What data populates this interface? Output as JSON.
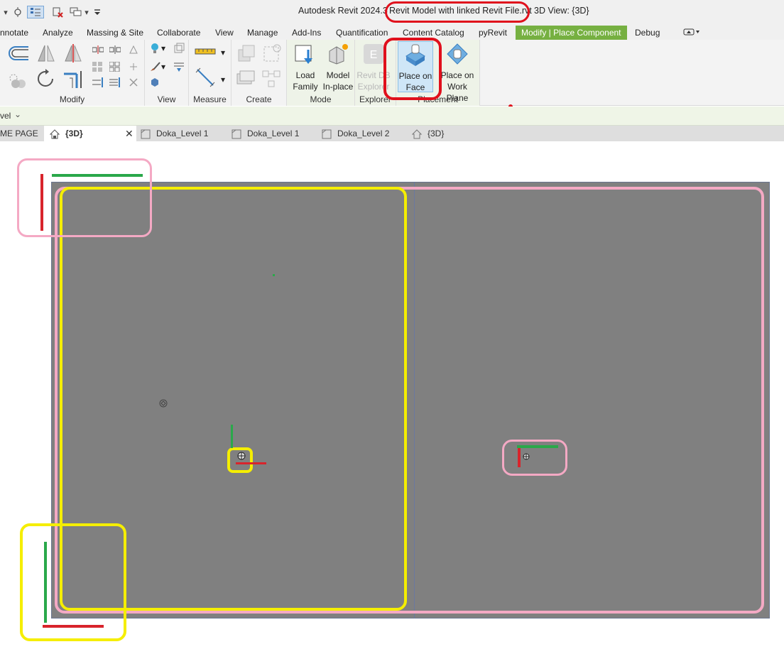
{
  "window": {
    "app_title": "Autodesk Revit 2024.3",
    "file_name": "Revit Model with linked Revit File.rvt",
    "view_title": "3D View: {3D}"
  },
  "ribbon_tabs": [
    "nnotate",
    "Analyze",
    "Massing & Site",
    "Collaborate",
    "View",
    "Manage",
    "Add-Ins",
    "Quantification",
    "Content Catalog",
    "pyRevit",
    "Modify | Place Component",
    "Debug"
  ],
  "ribbon": {
    "panels": {
      "modify": "Modify",
      "view": "View",
      "measure": "Measure",
      "create": "Create",
      "mode": "Mode",
      "explorer": "Explorer",
      "placement": "Placement"
    },
    "buttons": {
      "load_family": [
        "Load",
        "Family"
      ],
      "model_inplace": [
        "Model",
        "In-place"
      ],
      "revit_db_explorer": [
        "Revit DB",
        "Explorer"
      ],
      "place_on_face": [
        "Place on",
        "Face"
      ],
      "place_on_work_plane": [
        "Place on",
        "Work Plane"
      ]
    }
  },
  "options_bar": {
    "level_label": "vel"
  },
  "view_tabs": [
    "ME PAGE",
    "{3D}",
    "Doka_Level 1",
    "Doka_Level 1",
    "Doka_Level 2",
    "{3D}"
  ],
  "colors": {
    "accent_green": "#76b041",
    "annotation_red": "#e0101c",
    "annotation_pink": "#f4a9c4",
    "annotation_yellow": "#f5ee00",
    "viewport_gray": "#808080",
    "axis_green": "#2aa84a",
    "axis_red": "#d8242c"
  }
}
